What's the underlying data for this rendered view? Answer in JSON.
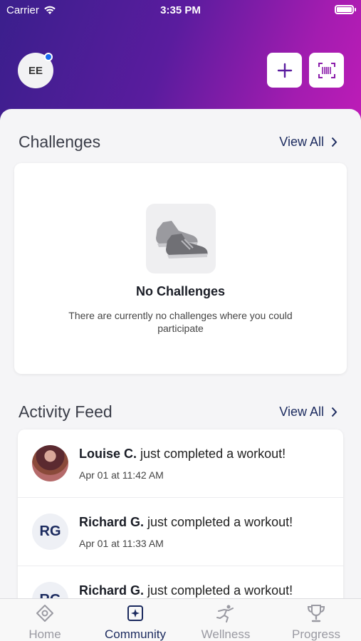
{
  "status_bar": {
    "carrier": "Carrier",
    "time": "3:35 PM"
  },
  "header": {
    "avatar_initials": "EE",
    "add_icon": "plus-icon",
    "scan_icon": "barcode-scan-icon",
    "gradient_colors": [
      "#3a1f8c",
      "#c01cb8"
    ]
  },
  "challenges": {
    "title": "Challenges",
    "view_all": "View All",
    "empty_title": "No Challenges",
    "empty_description": "There are currently no challenges where you could participate",
    "empty_icon": "sneakers-icon"
  },
  "activity_feed": {
    "title": "Activity Feed",
    "view_all": "View All",
    "items": [
      {
        "name": "Louise C.",
        "action": " just completed a workout!",
        "time": "Apr 01 at 11:42 AM",
        "avatar": "photo"
      },
      {
        "name": "Richard G.",
        "action": " just completed a workout!",
        "time": "Apr 01 at 11:33 AM",
        "avatar": "RG"
      },
      {
        "name": "Richard G.",
        "action": " just completed a workout!",
        "time": "",
        "avatar": "RG"
      }
    ]
  },
  "tabs": [
    {
      "label": "Home",
      "icon": "home-icon",
      "active": false
    },
    {
      "label": "Community",
      "icon": "community-icon",
      "active": true
    },
    {
      "label": "Wellness",
      "icon": "wellness-icon",
      "active": false
    },
    {
      "label": "Progress",
      "icon": "trophy-icon",
      "active": false
    }
  ],
  "colors": {
    "accent": "#1b2a5e",
    "notification_dot": "#1a6cf0"
  }
}
